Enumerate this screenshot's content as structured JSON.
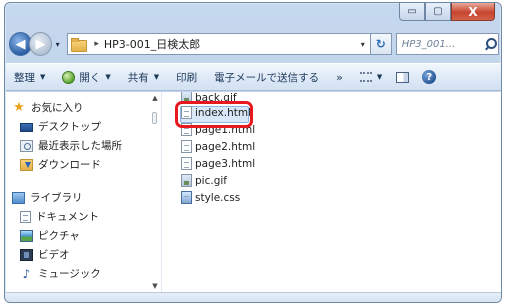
{
  "window": {
    "caption_buttons": {
      "minimize": "▭",
      "maximize": "▢",
      "close": "X"
    }
  },
  "address_bar": {
    "back_label": "◀",
    "forward_label": "▶",
    "dropdown_glyph": "▾",
    "separator": "▸",
    "path": [
      "HP3-001_日検太郎"
    ],
    "refresh_glyph": "↻",
    "search_placeholder": "HP3_001..."
  },
  "toolbar": {
    "organize": "整理",
    "open": "開く",
    "share": "共有",
    "print": "印刷",
    "email": "電子メールで送信する",
    "more": "»"
  },
  "nav_pane": {
    "favorites": {
      "label": "お気に入り",
      "items": [
        {
          "label": "デスクトップ",
          "icon": "desktop-icon"
        },
        {
          "label": "最近表示した場所",
          "icon": "recent-places-icon"
        },
        {
          "label": "ダウンロード",
          "icon": "download-folder-icon"
        }
      ]
    },
    "libraries": {
      "label": "ライブラリ",
      "items": [
        {
          "label": "ドキュメント",
          "icon": "document-icon"
        },
        {
          "label": "ピクチャ",
          "icon": "picture-icon"
        },
        {
          "label": "ビデオ",
          "icon": "video-icon"
        },
        {
          "label": "ミュージック",
          "icon": "music-icon"
        }
      ]
    }
  },
  "files": [
    {
      "name": "back.gif",
      "icon": "gif-file-icon"
    },
    {
      "name": "index.html",
      "icon": "html-file-icon",
      "highlighted": true
    },
    {
      "name": "page1.html",
      "icon": "html-file-icon"
    },
    {
      "name": "page2.html",
      "icon": "html-file-icon"
    },
    {
      "name": "page3.html",
      "icon": "html-file-icon"
    },
    {
      "name": "pic.gif",
      "icon": "gif-file-icon"
    },
    {
      "name": "style.css",
      "icon": "css-file-icon"
    }
  ],
  "colors": {
    "highlight_ring": "#e8181f",
    "window_frame": "#b5cbe5",
    "toolbar": "#dce8f6"
  }
}
